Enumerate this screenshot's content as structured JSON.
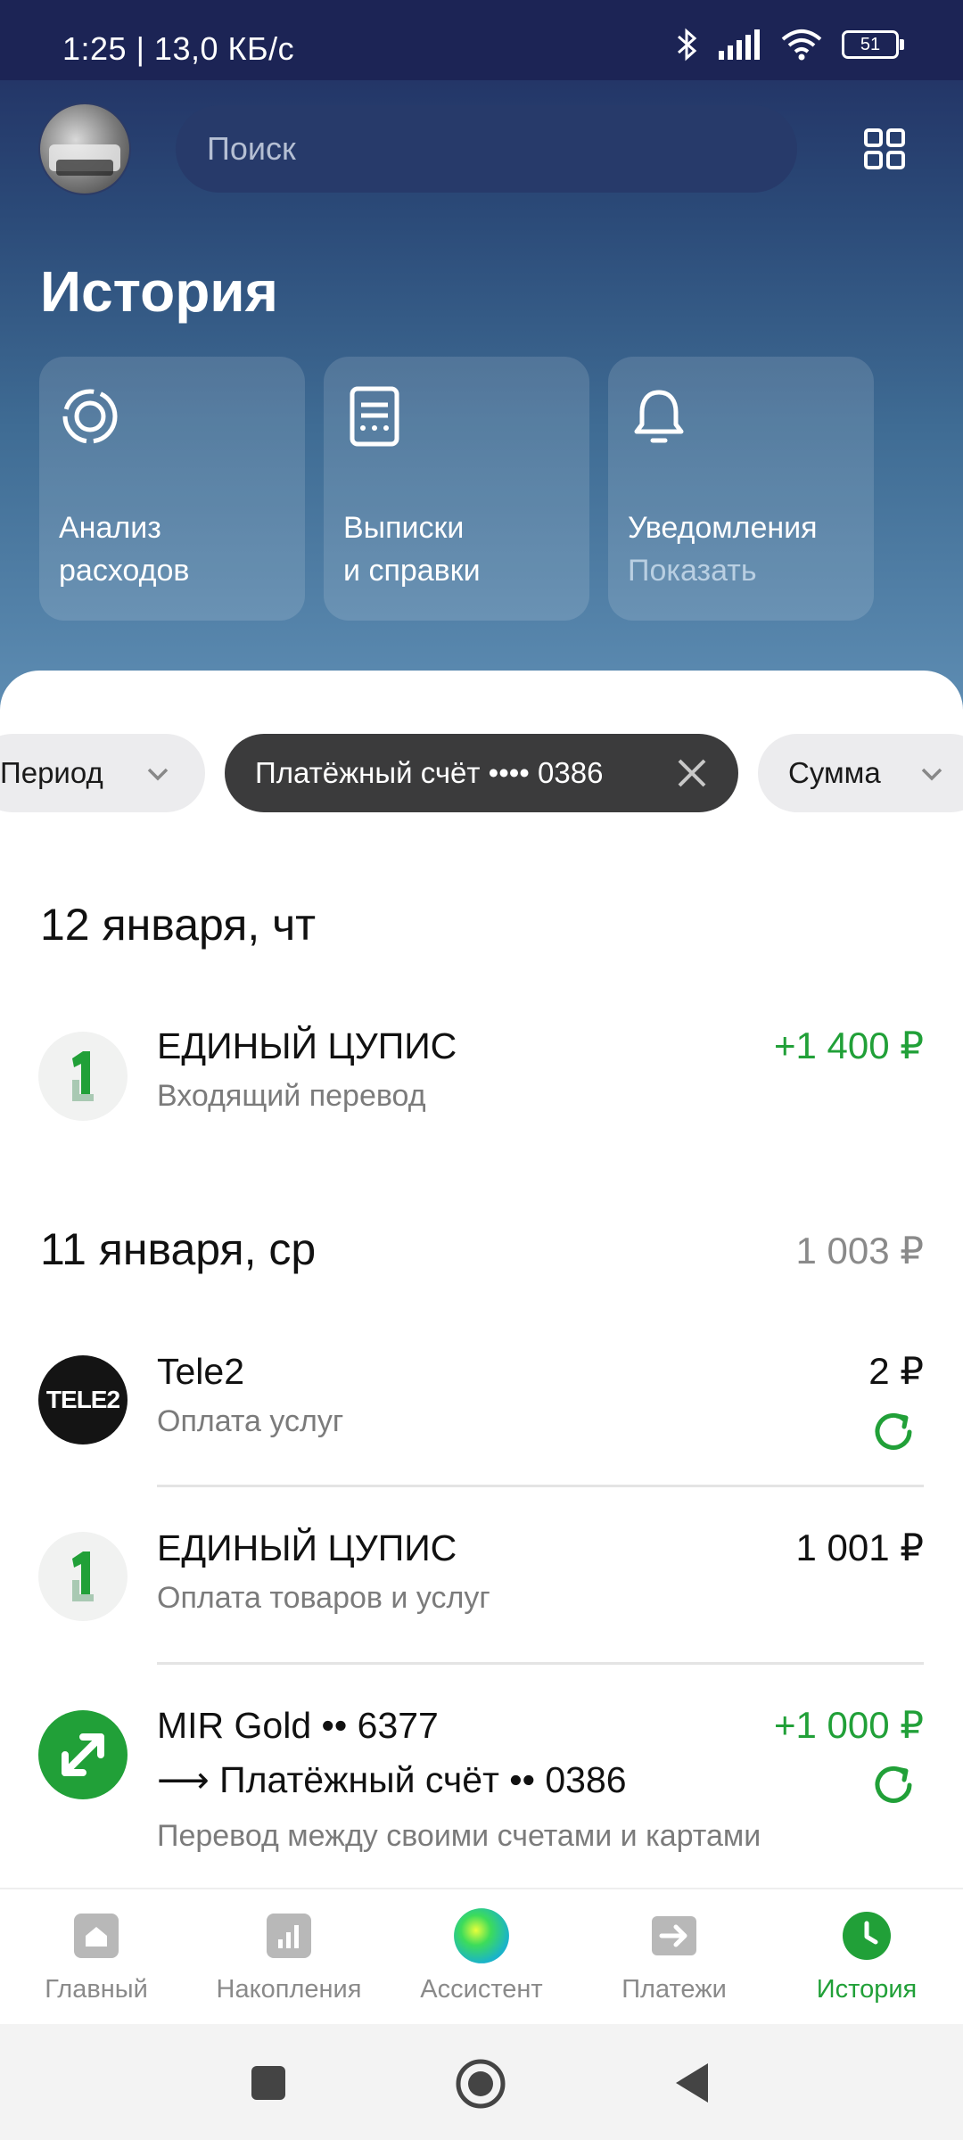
{
  "status": {
    "time": "1:25 | 13,0 КБ/с",
    "battery": "51"
  },
  "search": {
    "placeholder": "Поиск"
  },
  "header": {
    "title": "История"
  },
  "cards": [
    {
      "label": "Анализ\nрасходов",
      "icon": "donut-chart-icon"
    },
    {
      "label": "Выписки\nи справки",
      "icon": "document-icon"
    },
    {
      "label": "Уведомления",
      "sub": "Показать",
      "icon": "bell-icon"
    }
  ],
  "filters": [
    {
      "label": "Период",
      "type": "dropdown"
    },
    {
      "label": "Платёжный счёт •••• 0386",
      "type": "active"
    },
    {
      "label": "Сумма",
      "type": "dropdown"
    }
  ],
  "groups": [
    {
      "date": "12 января, чт",
      "total": "",
      "ops": [
        {
          "title": "ЕДИНЫЙ ЦУПИС",
          "subtitle": "Входящий перевод",
          "amount": "+1 400 ₽"
        }
      ]
    },
    {
      "date": "11 января, ср",
      "total": "1 003 ₽",
      "ops": [
        {
          "title": "Tele2",
          "subtitle": "Оплата услуг",
          "amount": "2 ₽",
          "logo_text": "TELE2"
        },
        {
          "title": "ЕДИНЫЙ ЦУПИС",
          "subtitle": "Оплата товаров и услуг",
          "amount": "1 001 ₽"
        },
        {
          "title": "MIR Gold •• 6377",
          "title2": "⟶ Платёжный счёт •• 0386",
          "subtitle": "Перевод между своими счетами и картами",
          "amount": "+1 000 ₽"
        }
      ]
    }
  ],
  "tabs": [
    {
      "label": "Главный"
    },
    {
      "label": "Накопления"
    },
    {
      "label": "Ассистент"
    },
    {
      "label": "Платежи"
    },
    {
      "label": "История",
      "active": true
    }
  ],
  "colors": {
    "accent": "#21a038",
    "header_top": "#1f2a5e",
    "header_bottom": "#5e8db3",
    "chip_dark": "#3b3b3c"
  }
}
